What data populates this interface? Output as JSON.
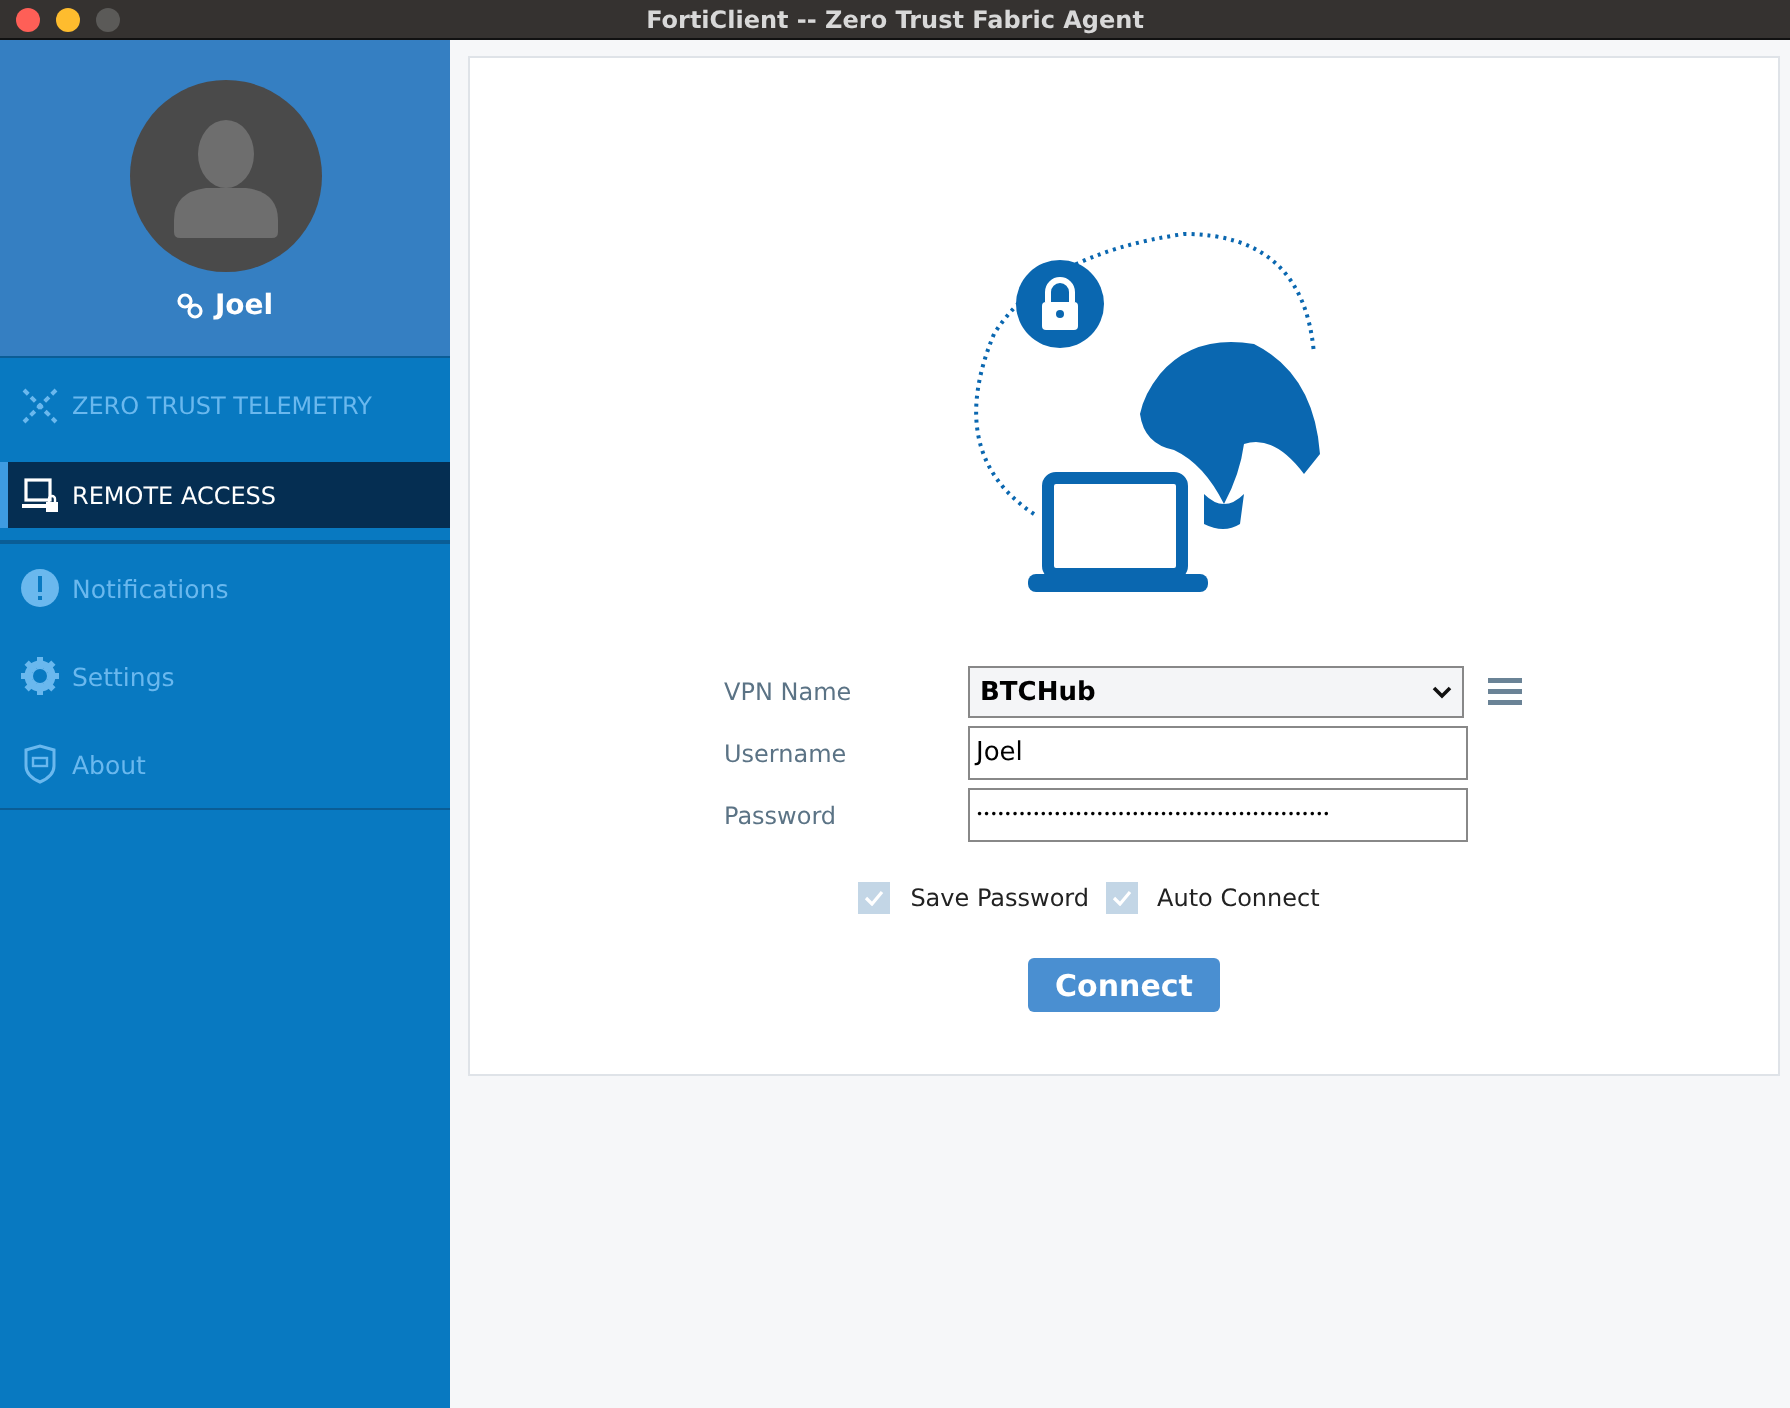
{
  "window": {
    "title": "FortiClient -- Zero Trust Fabric Agent"
  },
  "profile": {
    "name": "Joel"
  },
  "sidebar": {
    "items": [
      {
        "label": "ZERO TRUST TELEMETRY",
        "kind": "telemetry",
        "selected": false
      },
      {
        "label": "REMOTE ACCESS",
        "kind": "remote",
        "selected": true
      },
      {
        "label": "Notifications",
        "kind": "notifications",
        "selected": false
      },
      {
        "label": "Settings",
        "kind": "settings",
        "selected": false
      },
      {
        "label": "About",
        "kind": "about",
        "selected": false
      }
    ]
  },
  "form": {
    "vpn_name": {
      "label": "VPN Name",
      "value": "BTCHub"
    },
    "username": {
      "label": "Username",
      "value": "Joel"
    },
    "password": {
      "label": "Password",
      "value": "••••••••••••••••••••••••••••••••••••••••••••••••••"
    },
    "options": [
      {
        "label": "Save Password",
        "checked": true
      },
      {
        "label": "Auto Connect",
        "checked": true
      }
    ],
    "button": "Connect"
  }
}
